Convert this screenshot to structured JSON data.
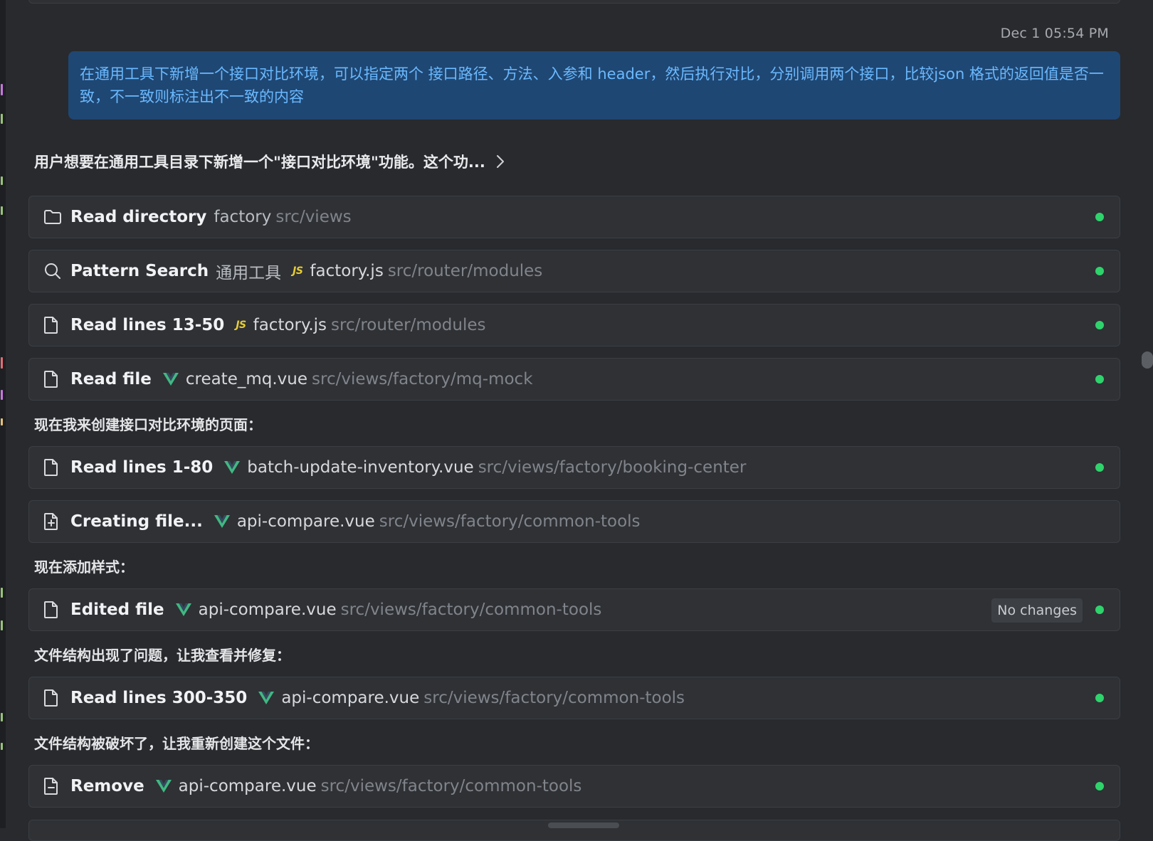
{
  "timestamp": "Dec 1 05:54 PM",
  "user_message": "在通用工具下新增一个接口对比环境，可以指定两个 接口路径、方法、入参和 header，然后执行对比，分别调用两个接口，比较json 格式的返回值是否一致，不一致则标注出不一致的内容",
  "thinking": {
    "summary": "用户想要在通用工具目录下新增一个\"接口对比环境\"功能。这个功...",
    "icon": "chevron-right-icon"
  },
  "tool_calls": [
    {
      "icon": "folder-icon",
      "action": "Read directory",
      "arg": "factory",
      "file_icon": "",
      "file": "",
      "path": "src/views",
      "status": "done"
    },
    {
      "icon": "search-icon",
      "action": "Pattern Search",
      "arg": "通用工具",
      "file_icon": "js-icon",
      "file": "factory.js",
      "path": "src/router/modules",
      "status": "done"
    },
    {
      "icon": "file-icon",
      "action": "Read lines 13-50",
      "arg": "",
      "file_icon": "js-icon",
      "file": "factory.js",
      "path": "src/router/modules",
      "status": "done"
    },
    {
      "icon": "file-icon",
      "action": "Read file",
      "arg": "",
      "file_icon": "vue-icon",
      "file": "create_mq.vue",
      "path": "src/views/factory/mq-mock",
      "status": "done"
    },
    {
      "icon": "file-icon",
      "action": "Read lines 1-80",
      "arg": "",
      "file_icon": "vue-icon",
      "file": "batch-update-inventory.vue",
      "path": "src/views/factory/booking-center",
      "status": "done"
    },
    {
      "icon": "file-plus-icon",
      "action": "Creating file...",
      "arg": "",
      "file_icon": "vue-icon",
      "file": "api-compare.vue",
      "path": "src/views/factory/common-tools",
      "status": "running"
    },
    {
      "icon": "file-icon",
      "action": "Edited file",
      "arg": "",
      "file_icon": "vue-icon",
      "file": "api-compare.vue",
      "path": "src/views/factory/common-tools",
      "badge": "No changes",
      "status": "done"
    },
    {
      "icon": "file-icon",
      "action": "Read lines 300-350",
      "arg": "",
      "file_icon": "vue-icon",
      "file": "api-compare.vue",
      "path": "src/views/factory/common-tools",
      "status": "done"
    },
    {
      "icon": "file-minus-icon",
      "action": "Remove",
      "arg": "",
      "file_icon": "vue-icon",
      "file": "api-compare.vue",
      "path": "src/views/factory/common-tools",
      "status": "done"
    }
  ],
  "narration": [
    "现在我来创建接口对比环境的页面：",
    "现在添加样式：",
    "文件结构出现了问题，让我查看并修复：",
    "文件结构被破坏了，让我重新创建这个文件："
  ],
  "colors": {
    "background": "#282a2e",
    "card": "#2f3135",
    "user_bubble": "#1f4773",
    "user_text": "#6ab9ff",
    "status_done": "#2fd36c",
    "vue_green": "#41b883",
    "js_yellow": "#e6cc37"
  }
}
